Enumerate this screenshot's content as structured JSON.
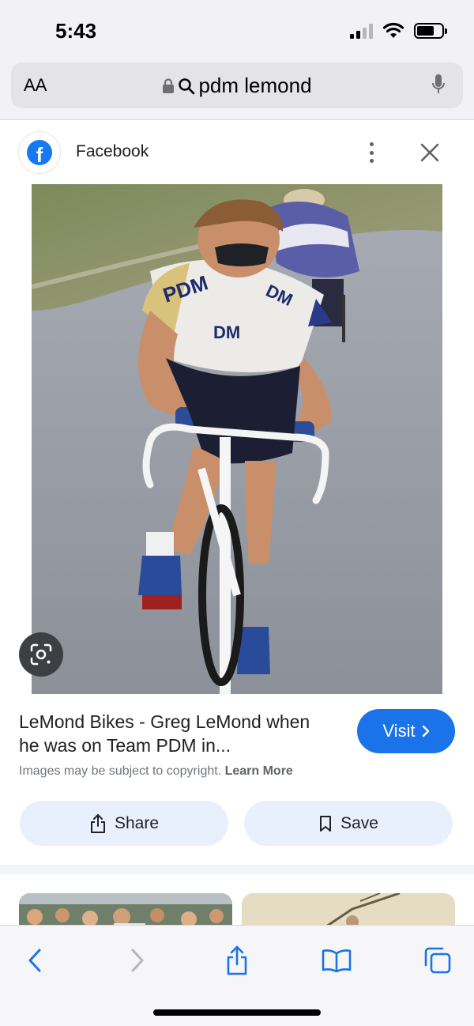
{
  "status_bar": {
    "time": "5:43"
  },
  "browser": {
    "text_size_label": "AA",
    "address": "pdm lemond"
  },
  "panel": {
    "source": "Facebook",
    "title": "LeMond Bikes - Greg LeMond when he was on Team PDM in...",
    "visit_label": "Visit",
    "copyright_text": "Images may be subject to copyright.",
    "learn_more": "Learn More",
    "share_label": "Share",
    "save_label": "Save"
  },
  "colors": {
    "accent": "#1a73e8",
    "pill_bg": "#e8f0fe",
    "ios_blue": "#1a73e8"
  }
}
